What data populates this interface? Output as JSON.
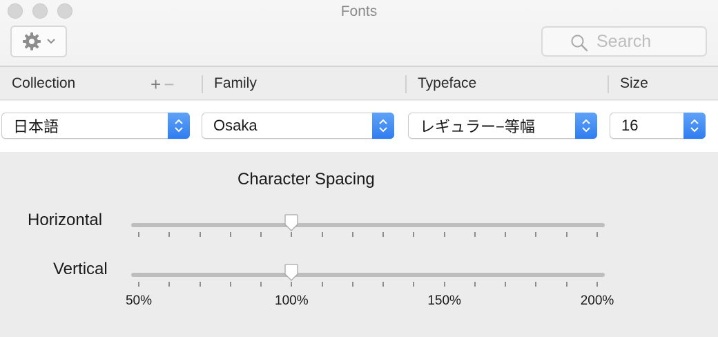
{
  "window": {
    "title": "Fonts"
  },
  "toolbar": {
    "search_placeholder": "Search",
    "action_menu_icon": "gear-icon"
  },
  "columns": {
    "collection": "Collection",
    "family": "Family",
    "typeface": "Typeface",
    "size": "Size",
    "add_symbol": "+",
    "remove_symbol": "−"
  },
  "selections": {
    "collection": "日本語",
    "family": "Osaka",
    "typeface": "レギュラー−等幅",
    "size": "16"
  },
  "spacing": {
    "title": "Character Spacing",
    "horizontal_label": "Horizontal",
    "vertical_label": "Vertical",
    "horizontal_value_percent": 100,
    "vertical_value_percent": 100,
    "min_percent": 50,
    "max_percent": 200,
    "tick_count": 16,
    "scale_labels": [
      "50%",
      "100%",
      "150%",
      "200%"
    ]
  },
  "colors": {
    "accent": "#2f7df1",
    "track": "#bdbdbd"
  }
}
